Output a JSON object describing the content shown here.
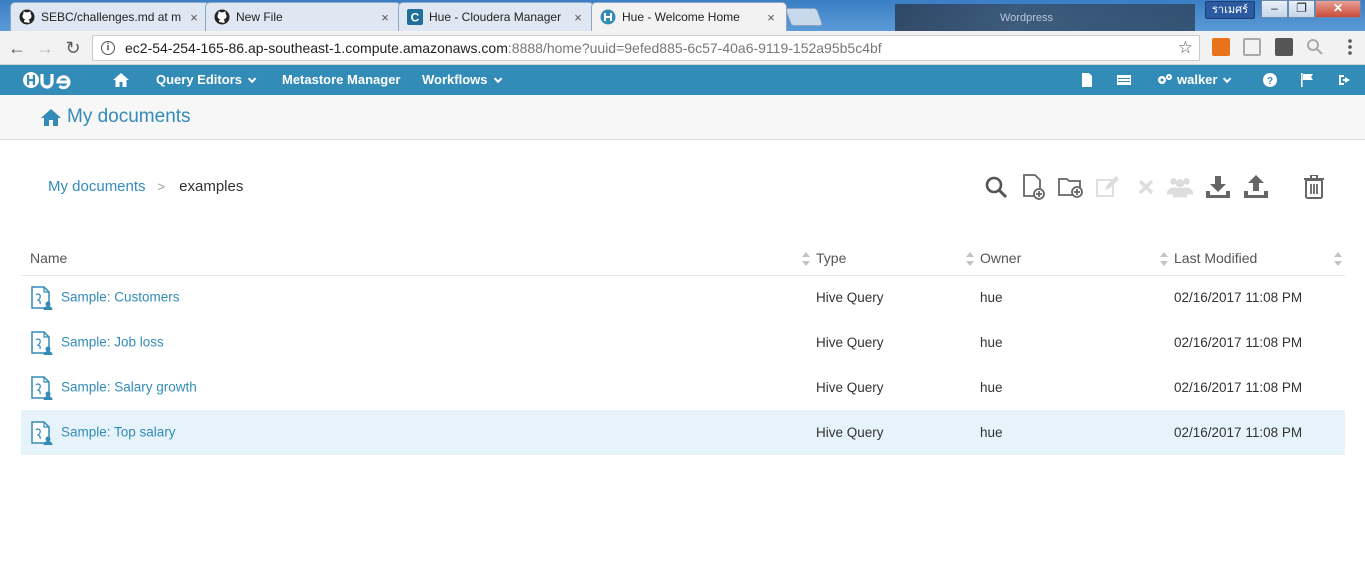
{
  "browser": {
    "tabs": [
      {
        "title": "SEBC/challenges.md at m",
        "favicon": "github-icon",
        "active": false
      },
      {
        "title": "New File",
        "favicon": "github-icon",
        "active": false
      },
      {
        "title": "Hue - Cloudera Manager",
        "favicon": "cloudera-icon",
        "active": false
      },
      {
        "title": "Hue - Welcome Home",
        "favicon": "hue-icon",
        "active": true
      }
    ],
    "close_glyph": "×",
    "window_user": "ราเมศร์",
    "background_text": "Wordpress",
    "url_host": "ec2-54-254-165-86.ap-southeast-1.compute.amazonaws.com",
    "url_rest": ":8888/home?uuid=9efed885-6c57-40a6-9119-152a95b5c4bf",
    "info_glyph": "i",
    "star_glyph": "☆",
    "back_glyph": "←",
    "forward_glyph": "→",
    "reload_glyph": "↻"
  },
  "hue_nav": {
    "query_editors": "Query Editors",
    "metastore_manager": "Metastore Manager",
    "workflows": "Workflows",
    "user": "walker"
  },
  "page": {
    "title": "My documents"
  },
  "breadcrumb": {
    "root": "My documents",
    "separator": ">",
    "current": "examples"
  },
  "table": {
    "columns": [
      "Name",
      "Type",
      "Owner",
      "Last Modified"
    ],
    "rows": [
      {
        "name": "Sample: Customers",
        "type": "Hive Query",
        "owner": "hue",
        "modified": "02/16/2017 11:08 PM"
      },
      {
        "name": "Sample: Job loss",
        "type": "Hive Query",
        "owner": "hue",
        "modified": "02/16/2017 11:08 PM"
      },
      {
        "name": "Sample: Salary growth",
        "type": "Hive Query",
        "owner": "hue",
        "modified": "02/16/2017 11:08 PM"
      },
      {
        "name": "Sample: Top salary",
        "type": "Hive Query",
        "owner": "hue",
        "modified": "02/16/2017 11:08 PM",
        "selected": true
      }
    ]
  },
  "colors": {
    "hue_blue": "#338bb8",
    "row_highlight": "#e6f3fb"
  }
}
